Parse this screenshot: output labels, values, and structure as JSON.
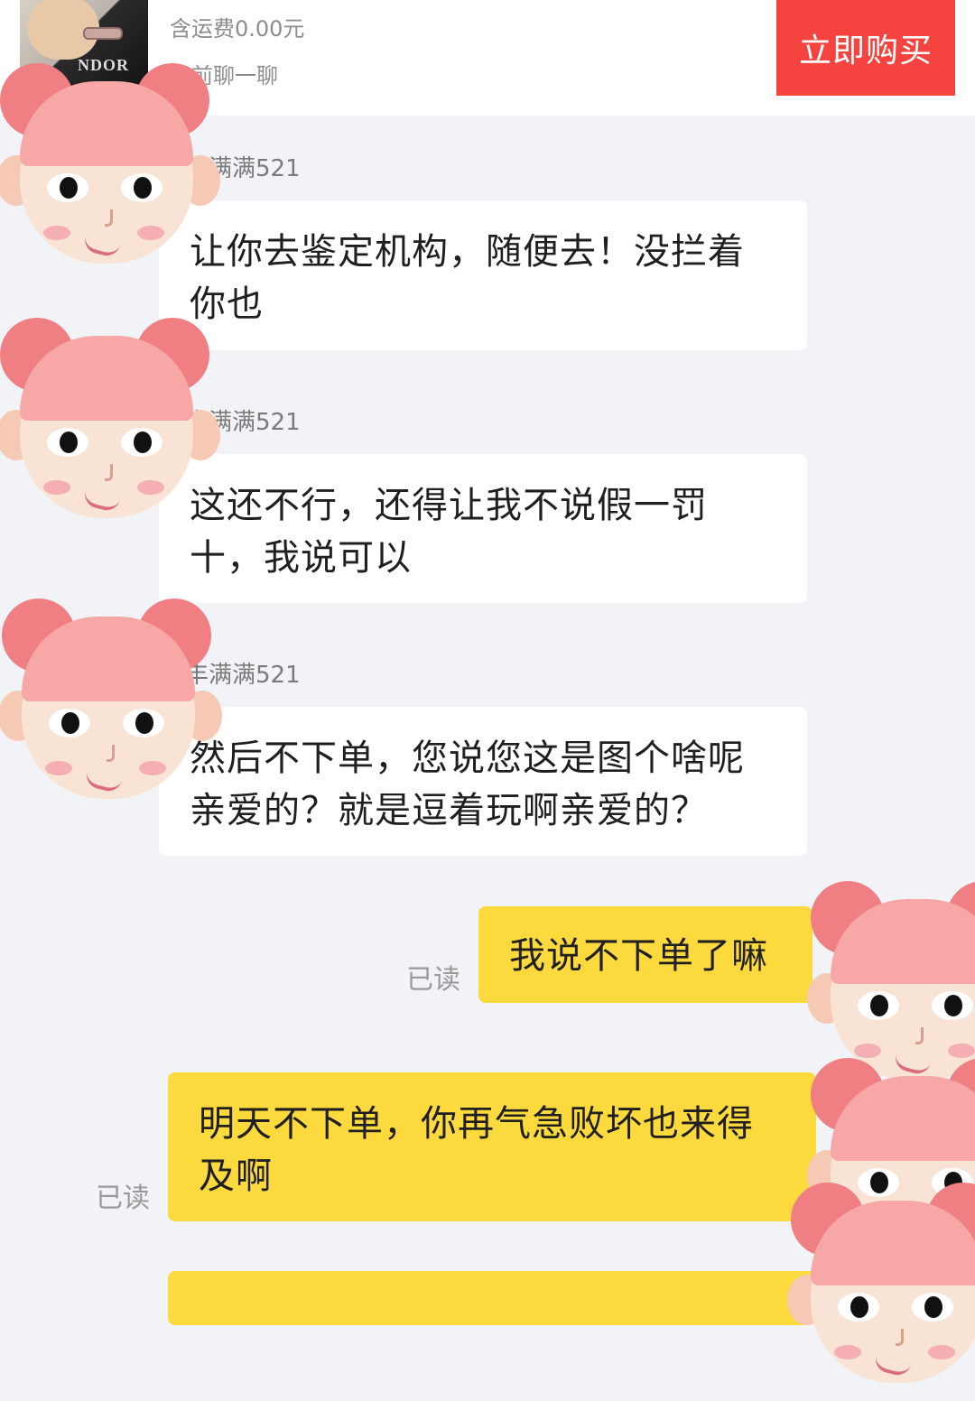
{
  "header": {
    "shipping": "含运费0.00元",
    "chat_link": "易前聊一聊",
    "buy_button": "立即购买",
    "thumb_text": "NDOR"
  },
  "messages": [
    {
      "sender": "丰满满521",
      "text_lines": [
        "让你去鉴定机构，随便去！没拦着",
        "你也"
      ]
    },
    {
      "sender": "丰满满521",
      "text_lines": [
        "这还不行，还得让我不说假一罚",
        "十，我说可以"
      ]
    },
    {
      "sender": "丰满满521",
      "text_lines": [
        "然后不下单，您说您这是图个啥呢",
        "亲爱的？就是逗着玩啊亲爱的？"
      ]
    }
  ],
  "outgoing": [
    {
      "status": "已读",
      "text_lines": [
        "我说不下单了嘛"
      ]
    },
    {
      "status": "已读",
      "text_lines": [
        "明天不下单，你再气急败坏也来得",
        "及啊"
      ]
    }
  ],
  "colors": {
    "background": "#f2f3f7",
    "buy_button": "#f5433f",
    "outgoing_bubble": "#fcd93c",
    "incoming_bubble": "#ffffff"
  },
  "icons": [
    "cartoon-girl-sticker-icon"
  ]
}
